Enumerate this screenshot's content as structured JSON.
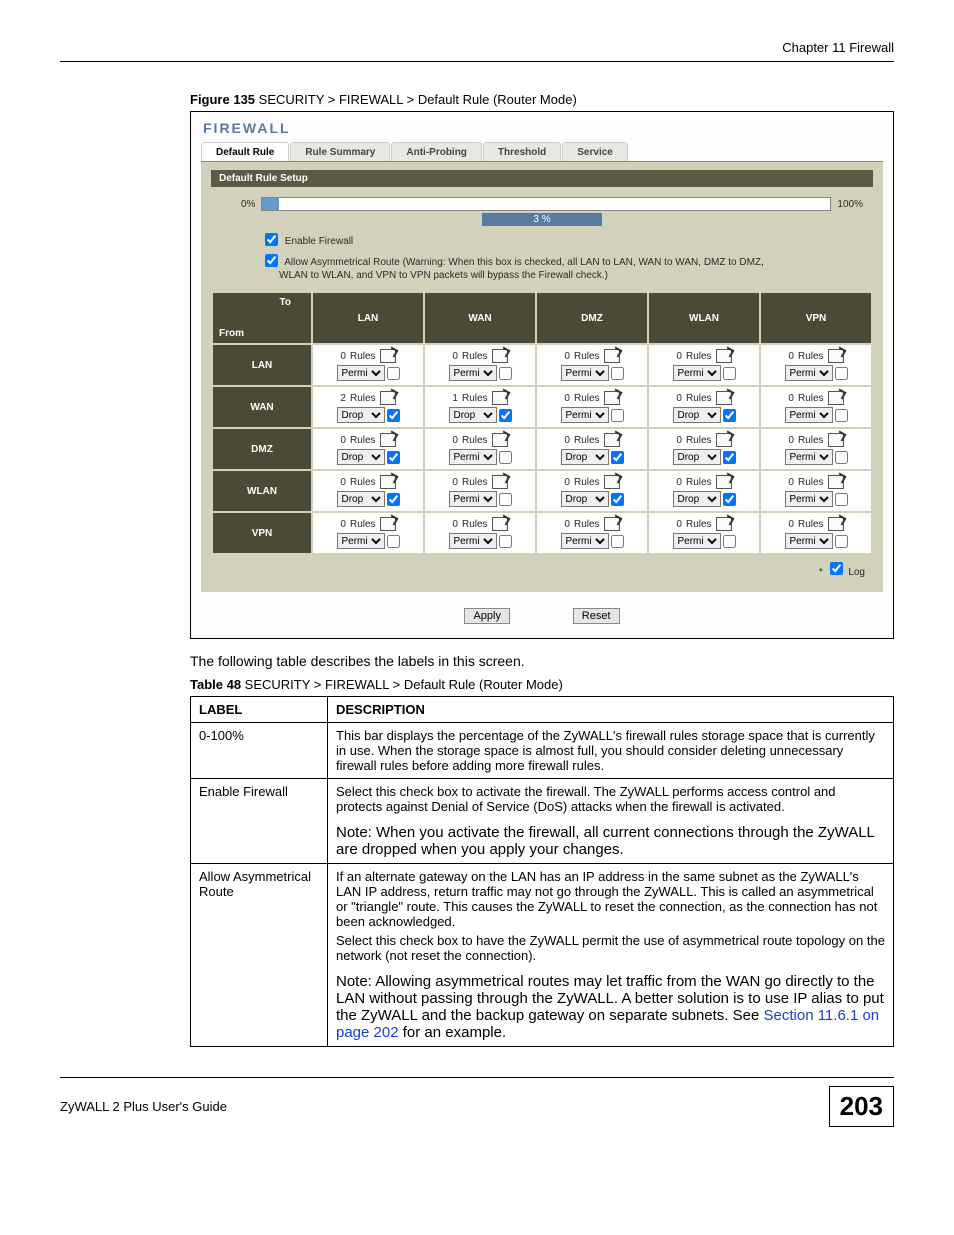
{
  "chapter_header": "Chapter 11 Firewall",
  "figure_caption_bold": "Figure 135",
  "figure_caption_rest": "   SECURITY > FIREWALL > Default Rule (Router Mode)",
  "shot": {
    "title": "FIREWALL",
    "tabs": [
      "Default Rule",
      "Rule Summary",
      "Anti-Probing",
      "Threshold",
      "Service"
    ],
    "panel_header": "Default Rule Setup",
    "bar_left": "0%",
    "bar_right": "100%",
    "bar_center": "3 %",
    "enable_firewall": "Enable Firewall",
    "allow_asym_line1": "Allow Asymmetrical Route (Warning: When this box is checked, all LAN to LAN, WAN to WAN, DMZ to DMZ,",
    "allow_asym_line2": "WLAN to WLAN, and VPN to VPN packets will bypass the Firewall check.)",
    "to_label": "To",
    "from_label": "From",
    "cols": [
      "LAN",
      "WAN",
      "DMZ",
      "WLAN",
      "VPN"
    ],
    "rows": [
      "LAN",
      "WAN",
      "DMZ",
      "WLAN",
      "VPN"
    ],
    "rules_word": "Rules",
    "apply": "Apply",
    "reset": "Reset",
    "log_label": "Log",
    "matrix": {
      "LAN": {
        "LAN": {
          "n": 0,
          "a": "Permit",
          "c": false
        },
        "WAN": {
          "n": 0,
          "a": "Permit",
          "c": false
        },
        "DMZ": {
          "n": 0,
          "a": "Permit",
          "c": false
        },
        "WLAN": {
          "n": 0,
          "a": "Permit",
          "c": false
        },
        "VPN": {
          "n": 0,
          "a": "Permit",
          "c": false
        }
      },
      "WAN": {
        "LAN": {
          "n": 2,
          "a": "Drop",
          "c": true
        },
        "WAN": {
          "n": 1,
          "a": "Drop",
          "c": true
        },
        "DMZ": {
          "n": 0,
          "a": "Permit",
          "c": false
        },
        "WLAN": {
          "n": 0,
          "a": "Drop",
          "c": true
        },
        "VPN": {
          "n": 0,
          "a": "Permit",
          "c": false
        }
      },
      "DMZ": {
        "LAN": {
          "n": 0,
          "a": "Drop",
          "c": true
        },
        "WAN": {
          "n": 0,
          "a": "Permit",
          "c": false
        },
        "DMZ": {
          "n": 0,
          "a": "Drop",
          "c": true
        },
        "WLAN": {
          "n": 0,
          "a": "Drop",
          "c": true
        },
        "VPN": {
          "n": 0,
          "a": "Permit",
          "c": false
        }
      },
      "WLAN": {
        "LAN": {
          "n": 0,
          "a": "Drop",
          "c": true
        },
        "WAN": {
          "n": 0,
          "a": "Permit",
          "c": false
        },
        "DMZ": {
          "n": 0,
          "a": "Drop",
          "c": true
        },
        "WLAN": {
          "n": 0,
          "a": "Drop",
          "c": true
        },
        "VPN": {
          "n": 0,
          "a": "Permit",
          "c": false
        }
      },
      "VPN": {
        "LAN": {
          "n": 0,
          "a": "Permit",
          "c": false
        },
        "WAN": {
          "n": 0,
          "a": "Permit",
          "c": false
        },
        "DMZ": {
          "n": 0,
          "a": "Permit",
          "c": false
        },
        "WLAN": {
          "n": 0,
          "a": "Permit",
          "c": false
        },
        "VPN": {
          "n": 0,
          "a": "Permit",
          "c": false
        }
      }
    }
  },
  "body_text": "The following table describes the labels in this screen.",
  "table_caption_bold": "Table 48",
  "table_caption_rest": "   SECURITY > FIREWALL > Default Rule (Router Mode)",
  "desc_head_label": "LABEL",
  "desc_head_desc": "DESCRIPTION",
  "desc_rows": [
    {
      "label": "0-100%",
      "desc": "This bar displays the percentage of the ZyWALL's firewall rules storage space that is currently in use. When the storage space is almost full, you should consider deleting unnecessary firewall rules before adding more firewall rules."
    },
    {
      "label": "Enable Firewall",
      "desc": "Select this check box to activate the firewall. The ZyWALL performs access control and protects against Denial of Service (DoS) attacks when the firewall is activated.",
      "note": "Note: When you activate the firewall, all current connections through the ZyWALL are dropped when you apply your changes."
    },
    {
      "label": "Allow Asymmetrical Route",
      "desc1": "If an alternate gateway on the LAN has an IP address in the same subnet as the ZyWALL's LAN IP address, return traffic may not go through the ZyWALL. This is called an asymmetrical or \"triangle\" route. This causes the ZyWALL to reset the connection, as the connection has not been acknowledged.",
      "desc2": "Select this check box to have the ZyWALL permit the use of asymmetrical route topology on the network (not reset the connection).",
      "note_pre": "Note: Allowing asymmetrical routes may let traffic from the WAN go directly to the LAN without passing through the ZyWALL. A better solution is to use IP alias to put the ZyWALL and the backup gateway on separate subnets. See ",
      "note_link": "Section 11.6.1 on page 202",
      "note_post": " for an example."
    }
  ],
  "footer_guide": "ZyWALL 2 Plus User's Guide",
  "page_number": "203"
}
